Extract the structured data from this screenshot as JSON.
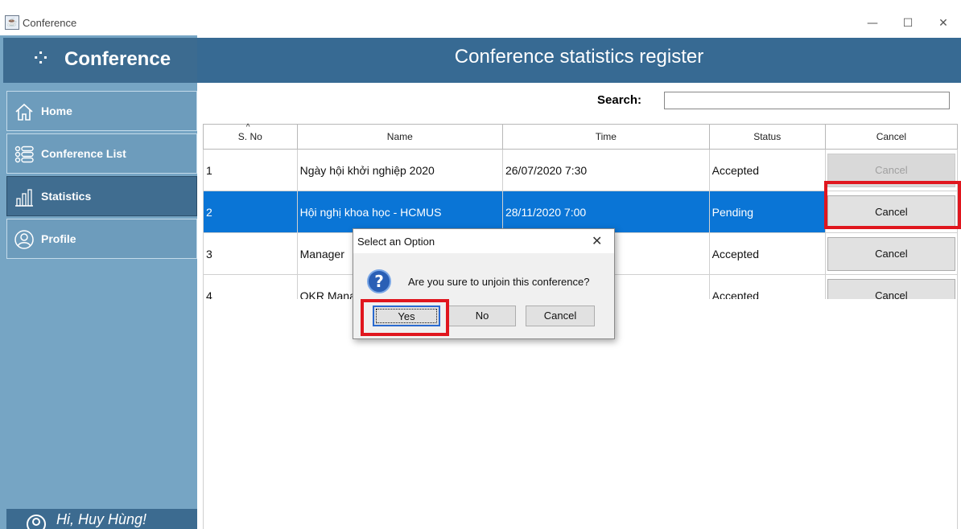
{
  "window": {
    "title": "Conference",
    "controls": [
      "—",
      "☐",
      "✕"
    ]
  },
  "sidebar": {
    "brand": "Conference",
    "items": [
      {
        "label": "Home",
        "icon": "home-icon"
      },
      {
        "label": "Conference List",
        "icon": "list-icon"
      },
      {
        "label": "Statistics",
        "icon": "chart-icon"
      },
      {
        "label": "Profile",
        "icon": "user-icon"
      }
    ],
    "active": "Statistics",
    "greeting": "Hi, Huy Hùng!"
  },
  "header": {
    "title": "Conference statistics register"
  },
  "search": {
    "label": "Search:",
    "value": ""
  },
  "table": {
    "columns": [
      "S. No",
      "Name",
      "Time",
      "Status",
      "Cancel"
    ],
    "rows": [
      {
        "sno": "1",
        "name": "Ngày hội khởi nghiệp 2020",
        "time": "26/07/2020 7:30",
        "status": "Accepted",
        "cancel": "Cancel"
      },
      {
        "sno": "2",
        "name": "Hội nghị khoa học - HCMUS",
        "time": "28/11/2020 7:00",
        "status": "Pending",
        "cancel": "Cancel"
      },
      {
        "sno": "3",
        "name": "Manager",
        "time": "",
        "status": "Accepted",
        "cancel": "Cancel"
      },
      {
        "sno": "4",
        "name": "OKR Mana",
        "time": "",
        "status": "Accepted",
        "cancel": "Cancel"
      }
    ]
  },
  "dialog": {
    "title": "Select an Option",
    "message": "Are you sure to unjoin this conference?",
    "buttons": {
      "yes": "Yes",
      "no": "No",
      "cancel": "Cancel"
    }
  },
  "colors": {
    "highlight": "#e0161e",
    "selection": "#0a75d6",
    "header": "#376a93",
    "sidebar": "#76a5c4"
  }
}
